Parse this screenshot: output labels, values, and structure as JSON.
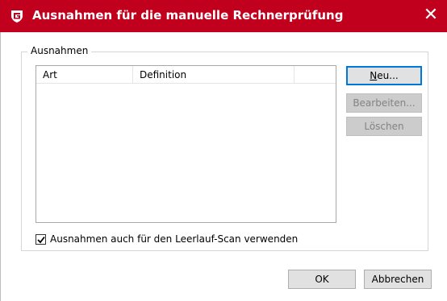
{
  "window": {
    "title": "Ausnahmen für die manuelle Rechnerprüfung",
    "accent_color": "#c1001e",
    "close_icon": "close-icon",
    "logo_icon": "gdata-shield-icon"
  },
  "group": {
    "legend": "Ausnahmen"
  },
  "list": {
    "columns": [
      "Art",
      "Definition"
    ],
    "rows": []
  },
  "side_buttons": {
    "new_prefix": "",
    "new_mnemonic": "N",
    "new_rest": "eu...",
    "edit": "Bearbeiten...",
    "delete": "Löschen"
  },
  "checkbox": {
    "label": "Ausnahmen auch für den Leerlauf-Scan verwenden",
    "checked": true
  },
  "footer": {
    "ok": "OK",
    "cancel": "Abbrechen"
  }
}
